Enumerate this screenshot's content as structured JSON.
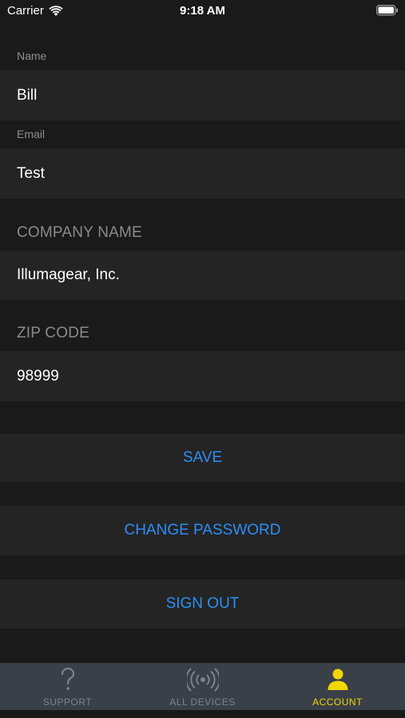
{
  "status_bar": {
    "carrier": "Carrier",
    "time": "9:18 AM"
  },
  "form": {
    "name_label": "Name",
    "name_value": "Bill",
    "email_label": "Email",
    "email_value": "Test",
    "company_header": "COMPANY NAME",
    "company_value": "Illumagear, Inc.",
    "zip_header": "ZIP CODE",
    "zip_value": "98999"
  },
  "actions": {
    "save_label": "SAVE",
    "change_password_label": "CHANGE PASSWORD",
    "sign_out_label": "SIGN OUT"
  },
  "tab_bar": {
    "tabs": [
      {
        "label": "SUPPORT",
        "icon": "question-mark-icon"
      },
      {
        "label": "ALL DEVICES",
        "icon": "broadcast-icon"
      },
      {
        "label": "ACCOUNT",
        "icon": "person-icon",
        "active": true
      }
    ]
  },
  "colors": {
    "background": "#1a1a1a",
    "row": "#242424",
    "accent_blue": "#2d8ef5",
    "tab_active": "#f2d600",
    "tab_bar": "#3a4048"
  }
}
